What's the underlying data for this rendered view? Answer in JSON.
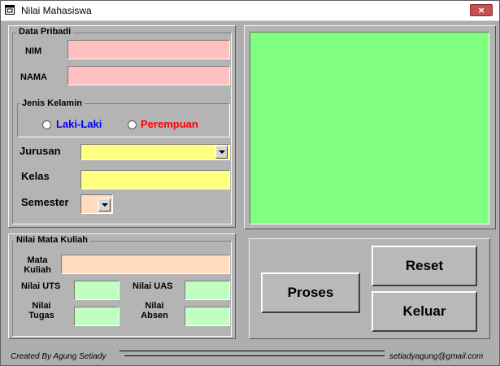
{
  "window": {
    "title": "Nilai Mahasiswa",
    "close_label": "×",
    "title_icon": "app-window-icon"
  },
  "data_pribadi": {
    "group_label": "Data Pribadi",
    "nim_label": "NIM",
    "nim_value": "",
    "nama_label": "NAMA",
    "nama_value": "",
    "gender_group_label": "Jenis Kelamin",
    "male_label": "Laki-Laki",
    "female_label": "Perempuan",
    "male_color": "#0000ff",
    "female_color": "#ff0000",
    "jurusan_label": "Jurusan",
    "jurusan_value": "",
    "kelas_label": "Kelas",
    "kelas_value": "",
    "semester_label": "Semester",
    "semester_value": ""
  },
  "nilai": {
    "group_label": "Nilai Mata Kuliah",
    "matkul_label_1": "Mata",
    "matkul_label_2": "Kuliah",
    "matkul_value": "",
    "uts_label": "Nilai UTS",
    "uts_value": "",
    "uas_label": "Nilai UAS",
    "uas_value": "",
    "tugas_label_1": "Nilai",
    "tugas_label_2": "Tugas",
    "tugas_value": "",
    "absen_label_1": "Nilai",
    "absen_label_2": "Absen",
    "absen_value": ""
  },
  "buttons": {
    "proses": "Proses",
    "reset": "Reset",
    "keluar": "Keluar"
  },
  "footer": {
    "left": "Created By Agung Setiady",
    "right": "setiadyagung@gmail.com"
  },
  "colors": {
    "window_bg": "#b4b4b4",
    "result_panel": "#80ff80",
    "field_pink": "#ffc0c0",
    "field_yellow": "#ffff80",
    "field_peach": "#ffdcc0",
    "field_mint": "#c0ffc0"
  }
}
